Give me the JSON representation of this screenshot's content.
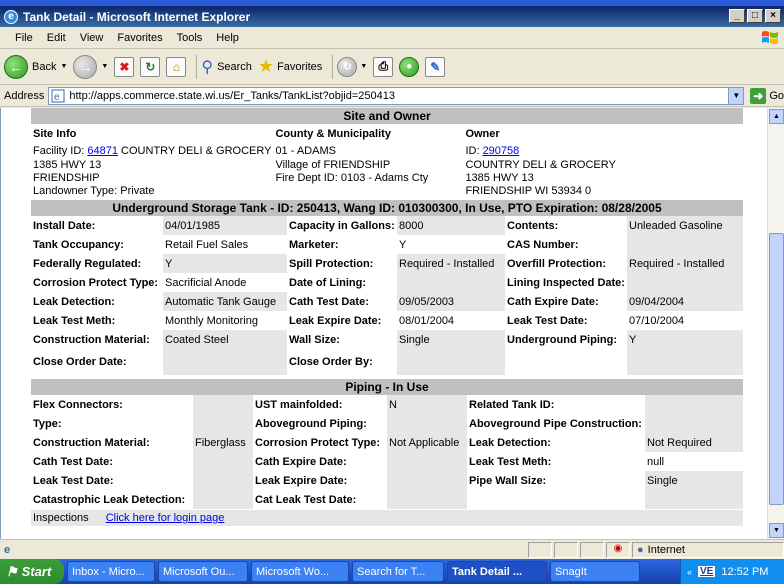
{
  "window": {
    "title": "Tank Detail - Microsoft Internet Explorer",
    "controls": [
      "_",
      "□",
      "×"
    ]
  },
  "menu": [
    "File",
    "Edit",
    "View",
    "Favorites",
    "Tools",
    "Help"
  ],
  "toolbar": {
    "back_label": "Back",
    "search_label": "Search",
    "favorites_label": "Favorites"
  },
  "address": {
    "label": "Address",
    "url": "http://apps.commerce.state.wi.us/Er_Tanks/TankList?objid=250413",
    "go_label": "Go"
  },
  "site_owner": {
    "header": "Site and Owner",
    "col1_header": "Site Info",
    "col2_header": "County & Municipality",
    "col3_header": "Owner",
    "facility_prefix": "Facility ID: ",
    "facility_id": "64871",
    "facility_name": " COUNTRY DELI & GROCERY",
    "site_address": "1385 HWY 13",
    "site_city": "FRIENDSHIP",
    "landowner": "Landowner Type: Private",
    "county": "01 - ADAMS",
    "village": "Village of FRIENDSHIP",
    "fire_dept": "Fire Dept ID: 0103 - Adams Cty",
    "owner_prefix": "ID: ",
    "owner_id": "290758",
    "owner_name": "COUNTRY DELI & GROCERY",
    "owner_address": "1385 HWY 13",
    "owner_city": "FRIENDSHIP WI 53934 0"
  },
  "tank": {
    "header": "Underground Storage Tank - ID: 250413, Wang ID: 010300300, In Use, PTO Expiration: 08/28/2005",
    "rows": [
      [
        "Install Date:",
        "04/01/1985",
        "Capacity in Gallons:",
        "8000",
        "Contents:",
        "Unleaded Gasoline"
      ],
      [
        "Tank Occupancy:",
        "Retail Fuel Sales",
        "Marketer:",
        "Y",
        "CAS Number:",
        ""
      ],
      [
        "Federally Regulated:",
        "Y",
        "Spill Protection:",
        "Required - Installed",
        "Overfill Protection:",
        "Required - Installed"
      ],
      [
        "Corrosion Protect Type:",
        "Sacrificial Anode",
        "Date of Lining:",
        "",
        "Lining Inspected Date:",
        ""
      ],
      [
        "Leak Detection:",
        "Automatic Tank Gauge",
        "Cath Test Date:",
        "09/05/2003",
        "Cath Expire Date:",
        "09/04/2004"
      ],
      [
        "Leak Test Meth:",
        "Monthly Monitoring",
        "Leak Expire Date:",
        "08/01/2004",
        "Leak Test Date:",
        "07/10/2004"
      ],
      [
        "Construction Material:",
        "Coated Steel",
        "Wall Size:",
        "Single",
        "Underground Piping:",
        "Y"
      ],
      [
        "Close Order Date:",
        "",
        "Close Order By:",
        "",
        "",
        ""
      ]
    ]
  },
  "piping": {
    "header": "Piping - In Use",
    "rows": [
      [
        "Flex Connectors:",
        "",
        "UST mainfolded:",
        "N",
        "Related Tank ID:",
        ""
      ],
      [
        "Type:",
        "",
        "Aboveground Piping:",
        "",
        "Aboveground Pipe Construction:",
        ""
      ],
      [
        "Construction Material:",
        "Fiberglass",
        "Corrosion Protect Type:",
        "Not Applicable",
        "Leak Detection:",
        "Not Required"
      ],
      [
        "Cath Test Date:",
        "",
        "Cath Expire Date:",
        "",
        "Leak Test Meth:",
        "null"
      ],
      [
        "Leak Test Date:",
        "",
        "Leak Expire Date:",
        "",
        "Pipe Wall Size:",
        "Single"
      ],
      [
        "Catastrophic Leak Detection:",
        "",
        "Cat Leak Test Date:",
        "",
        "",
        ""
      ]
    ]
  },
  "inspections": {
    "label": "Inspections",
    "link": "Click here for login page"
  },
  "status": {
    "zone": "Internet"
  },
  "taskbar": {
    "start": "Start",
    "tasks": [
      "Inbox - Micro...",
      "Microsoft Ou...",
      "Microsoft Wo...",
      "Search for T...",
      "Tank Detail ...",
      "SnagIt"
    ],
    "tray_icon": "VE",
    "time": "12:52 PM"
  }
}
